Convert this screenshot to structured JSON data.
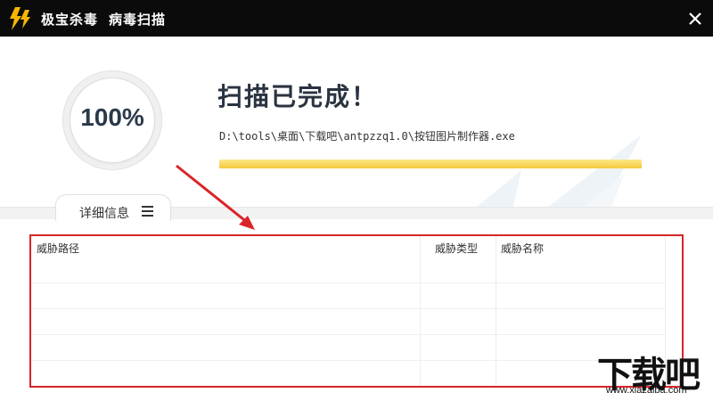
{
  "titlebar": {
    "app_name": "极宝杀毒",
    "window_title": "病毒扫描",
    "logo_icon": "lightning-icon",
    "close_icon": "close-icon"
  },
  "scan": {
    "progress_percent_text": "100%",
    "progress_fraction": 1.0,
    "heading": "扫描已完成！",
    "current_file": "D:\\tools\\桌面\\下载吧\\antpzzq1.0\\按钮图片制作器.exe"
  },
  "detail_tab": {
    "label": "详细信息",
    "icon": "menu-icon"
  },
  "table": {
    "columns": [
      "威胁路径",
      "威胁类型",
      "威胁名称"
    ],
    "rows": []
  },
  "watermark": {
    "text": "下载吧",
    "url": "www.xiazaiba.com"
  },
  "colors": {
    "titlebar_bg": "#0b0b0b",
    "progress_bar": "#f6c83c",
    "highlight_border": "#d9242a"
  }
}
